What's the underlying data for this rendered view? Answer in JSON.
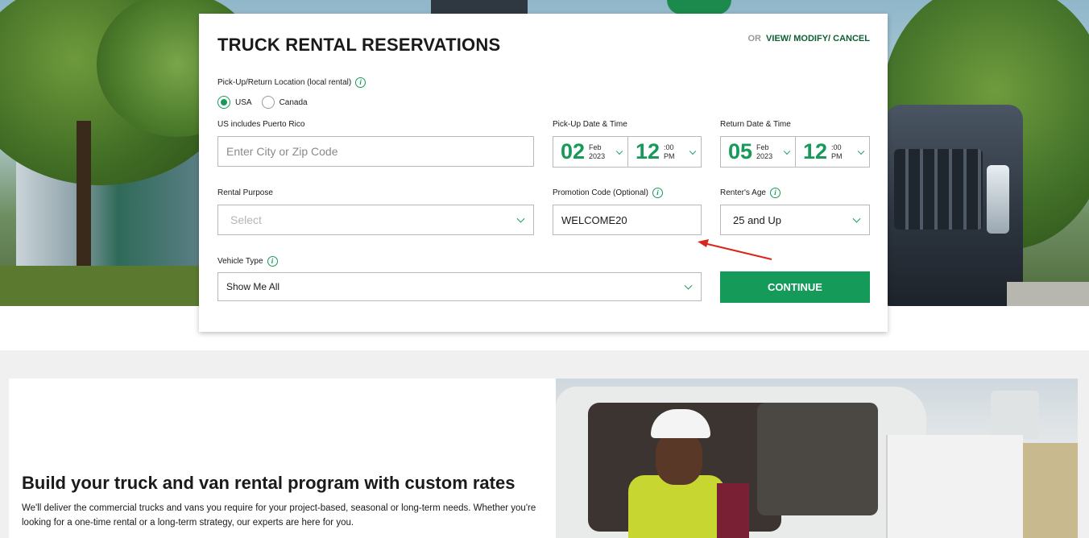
{
  "reservation": {
    "title": "TRUCK RENTAL RESERVATIONS",
    "or_label": "OR",
    "view_modify_cancel": "VIEW/ MODIFY/ CANCEL",
    "location_label": "Pick-Up/Return Location (local rental)",
    "country_options": [
      "USA",
      "Canada"
    ],
    "selected_country": "USA",
    "us_note": "US includes Puerto Rico",
    "location_placeholder": "Enter City or Zip Code",
    "pickup": {
      "label": "Pick-Up Date & Time",
      "day": "02",
      "month": "Feb",
      "year": "2023",
      "hour": "12",
      "minutes": ":00",
      "ampm": "PM"
    },
    "return": {
      "label": "Return Date & Time",
      "day": "05",
      "month": "Feb",
      "year": "2023",
      "hour": "12",
      "minutes": ":00",
      "ampm": "PM"
    },
    "rental_purpose_label": "Rental Purpose",
    "rental_purpose_placeholder": "Select",
    "promo_label": "Promotion Code (Optional)",
    "promo_value": "WELCOME20",
    "age_label": "Renter's Age",
    "age_value": "25 and Up",
    "vehicle_type_label": "Vehicle Type",
    "vehicle_type_value": "Show Me All",
    "continue_label": "CONTINUE"
  },
  "promo_section": {
    "title": "Build your truck and van rental program with custom rates",
    "text": "We'll deliver the commercial trucks and vans you require for your project-based, seasonal or long-term needs. Whether you're looking for a one-time rental or a long-term strategy, our experts are here for you."
  },
  "colors": {
    "brand_green": "#169a5a",
    "dark_green": "#0f5e33",
    "annotation_red": "#d9261c"
  },
  "icons": [
    "info-icon",
    "chevron-down-icon",
    "radio-icon",
    "annotation-arrow-icon"
  ]
}
